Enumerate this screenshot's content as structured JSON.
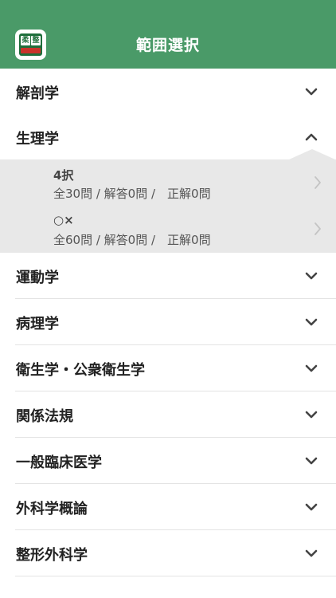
{
  "header": {
    "title": "範囲選択",
    "app_icon_chars": [
      "柔",
      "整"
    ]
  },
  "subjects": [
    {
      "label": "解剖学",
      "expanded": false
    },
    {
      "label": "生理学",
      "expanded": true
    },
    {
      "label": "運動学",
      "expanded": false
    },
    {
      "label": "病理学",
      "expanded": false
    },
    {
      "label": "衛生学・公衆衛生学",
      "expanded": false
    },
    {
      "label": "関係法規",
      "expanded": false
    },
    {
      "label": "一般臨床医学",
      "expanded": false
    },
    {
      "label": "外科学概論",
      "expanded": false
    },
    {
      "label": "整形外科学",
      "expanded": false
    }
  ],
  "expanded_items": [
    {
      "title": "4択",
      "stats": "全30問 / 解答0問 /　正解0問"
    },
    {
      "title": "○×",
      "stats": "全60問 / 解答0問 /　正解0問"
    }
  ],
  "colors": {
    "header_bg": "#4a9a68",
    "expanded_bg": "#e8e8e8",
    "chevron": "#444444"
  },
  "icons": {
    "collapsed": "chevron-down-icon",
    "expanded": "chevron-up-icon",
    "sub_item": "chevron-right-icon"
  }
}
